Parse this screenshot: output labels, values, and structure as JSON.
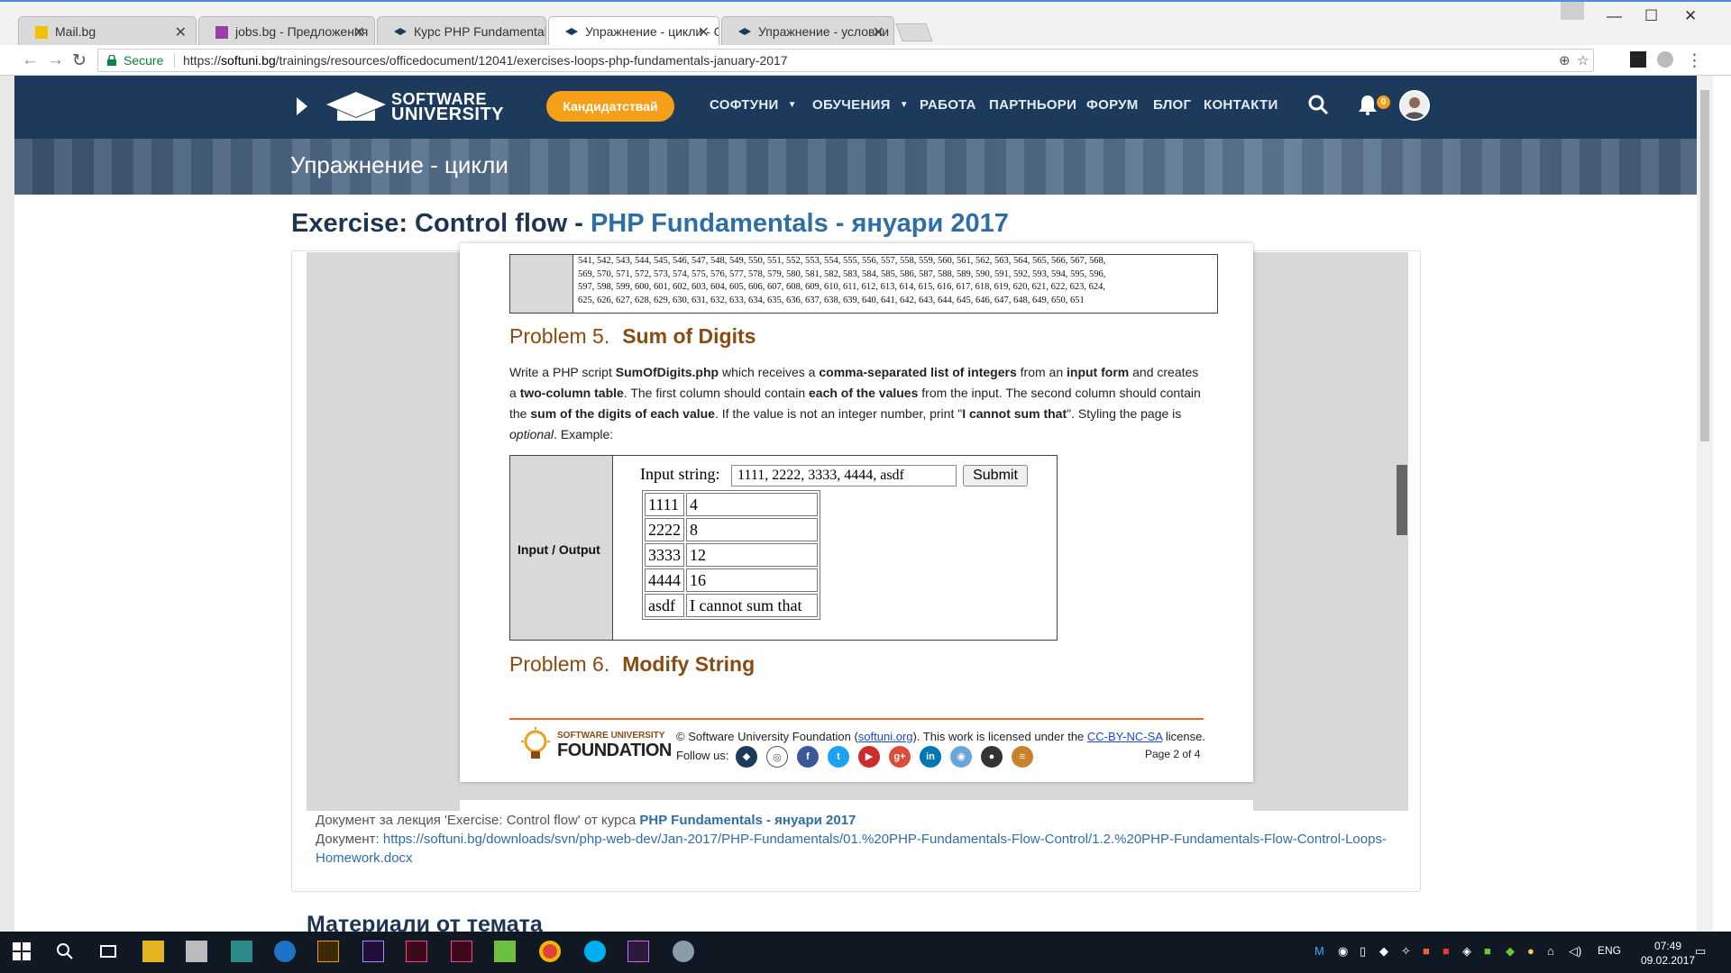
{
  "browser": {
    "tabs": [
      {
        "label": "Mail.bg",
        "color": "#f2c200"
      },
      {
        "label": "jobs.bg - Предложения",
        "color": "#9b3fa8"
      },
      {
        "label": "Курс PHP Fundamentals",
        "color": "#1b3a5c"
      },
      {
        "label": "Упражнение - цикли - С",
        "color": "#1b3a5c"
      },
      {
        "label": "Упражнение - условни",
        "color": "#1b3a5c"
      }
    ],
    "secure_label": "Secure",
    "url_prefix": "https://",
    "url_host": "softuni.bg",
    "url_path": "/trainings/resources/officedocument/12041/exercises-loops-php-fundamentals-january-2017"
  },
  "header": {
    "logo_line1": "SOFTWARE",
    "logo_line2": "UNIVERSITY",
    "cta_label": "Кандидатствай",
    "nav": [
      {
        "label": "СОФТУНИ",
        "caret": "▼"
      },
      {
        "label": "ОБУЧЕНИЯ",
        "caret": "▼"
      },
      {
        "label": "РАБОТА"
      },
      {
        "label": "ПАРТНЬОРИ"
      },
      {
        "label": "ФОРУМ"
      },
      {
        "label": "БЛОГ"
      },
      {
        "label": "КОНТАКТИ"
      }
    ],
    "notification_count": "0"
  },
  "banner": {
    "title": "Упражнение - цикли"
  },
  "page": {
    "title_main": "Exercise: Control flow - ",
    "title_course": "PHP Fundamentals - януари 2017"
  },
  "doc": {
    "numbers_text": [
      "541, 542, 543, 544, 545, 546, 547, 548, 549, 550, 551, 552, 553, 554, 555, 556, 557, 558, 559, 560, 561, 562, 563, 564, 565, 566, 567, 568,",
      "569, 570, 571, 572, 573, 574, 575, 576, 577, 578, 579, 580, 581, 582, 583, 584, 585, 586, 587, 588, 589, 590, 591, 592, 593, 594, 595, 596,",
      "597, 598, 599, 600, 601, 602, 603, 604, 605, 606, 607, 608, 609, 610, 611, 612, 613, 614, 615, 616, 617, 618, 619, 620, 621, 622, 623, 624,",
      "625, 626, 627, 628, 629, 630, 631, 632, 633, 634, 635, 636, 637, 638, 639, 640, 641, 642, 643, 644, 645, 646, 647, 648, 649, 650, 651"
    ],
    "problem5_num": "Problem 5.",
    "problem5_title": "Sum of Digits",
    "p5_text": {
      "a": "Write a PHP script ",
      "b": "SumOfDigits.php",
      "c": " which receives a ",
      "d": "comma-separated list of integers",
      "e": " from an ",
      "f": "input form",
      "g": " and creates a ",
      "h": "two-column table",
      "i": ". The first column should contain ",
      "j": "each of the values",
      "k": " from the input. The second column should contain the ",
      "l": "sum of the digits of each value",
      "m": ". If the value is not an integer number, print \"",
      "n": "I cannot sum that",
      "o": "\". Styling the page is ",
      "p": "optional",
      "q": ". Example:"
    },
    "io_label": "Input / Output",
    "input_label": "Input string:",
    "input_value": "1111, 2222, 3333, 4444, asdf",
    "submit_label": "Submit",
    "rows": [
      {
        "value": "1111",
        "sum": "4"
      },
      {
        "value": "2222",
        "sum": "8"
      },
      {
        "value": "3333",
        "sum": "12"
      },
      {
        "value": "4444",
        "sum": "16"
      },
      {
        "value": "asdf",
        "sum": "I cannot sum that"
      }
    ],
    "problem6_num": "Problem 6.",
    "problem6_title": "Modify String",
    "footer": {
      "logo_small": "SOFTWARE UNIVERSITY",
      "logo_big": "FOUNDATION",
      "copyright_a": "© Software University Foundation (",
      "copyright_link": "softuni.org",
      "copyright_b": "). This work is licensed under the ",
      "license_link": "CC-BY-NC-SA",
      "copyright_c": " license.",
      "follow_label": "Follow us:",
      "page_label": "Page 2 of 4"
    }
  },
  "meta": {
    "line1_prefix": "Документ за лекция 'Exercise: Control flow' от курса ",
    "line1_course": "PHP Fundamentals - януари 2017",
    "line2_prefix": "Документ: ",
    "line2_url": "https://softuni.bg/downloads/svn/php-web-dev/Jan-2017/PHP-Fundamentals/01.%20PHP-Fundamentals-Flow-Control/1.2.%20PHP-Fundamentals-Flow-Control-Loops-Homework.docx"
  },
  "section": {
    "title": "Материали от темата"
  },
  "taskbar": {
    "language": "ENG",
    "time": "07:49",
    "date": "09.02.2017"
  }
}
